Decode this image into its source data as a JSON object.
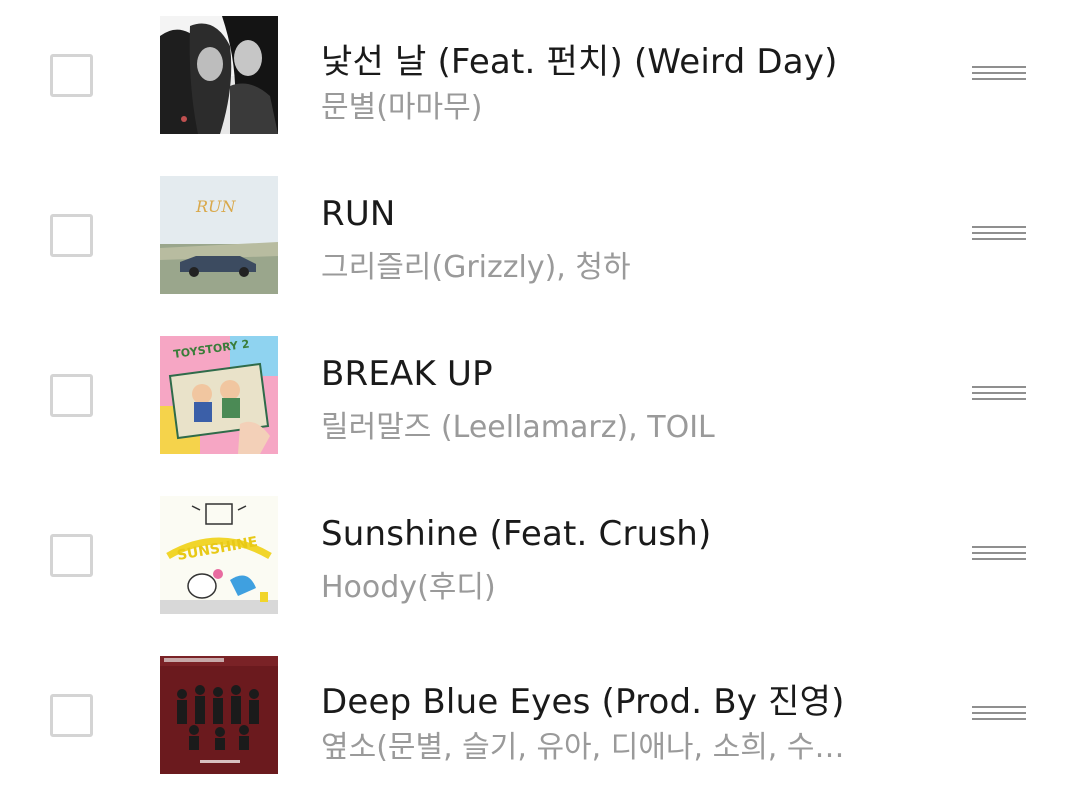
{
  "tracks": [
    {
      "title": "낯선 날 (Feat. 펀치) (Weird Day)",
      "artist": "문별(마마무)",
      "art_icon": "album-art-grayscale-photo",
      "checked": false
    },
    {
      "title": "RUN",
      "artist": "그리즐리(Grizzly), 청하",
      "art_icon": "album-art-car-field",
      "art_text": "RUN",
      "checked": false
    },
    {
      "title": "BREAK UP",
      "artist": "릴러말즈 (Leellamarz), TOIL",
      "art_icon": "album-art-toy-story",
      "art_text": "TOYSTORY 2",
      "checked": false
    },
    {
      "title": "Sunshine (Feat. Crush)",
      "artist": "Hoody(후디)",
      "art_icon": "album-art-sunshine-cartoon",
      "art_text": "SUNSHINE",
      "checked": false
    },
    {
      "title": "Deep Blue Eyes (Prod. By 진영)",
      "artist": "옆소(문별, 슬기, 유아, 디애나, 소희, 수…",
      "art_icon": "album-art-group-red",
      "checked": false
    }
  ],
  "colors": {
    "title": "#1a1a1a",
    "artist": "#9a9a9a",
    "checkbox_border": "#d4d4d4",
    "handle": "#8f8f8f"
  }
}
